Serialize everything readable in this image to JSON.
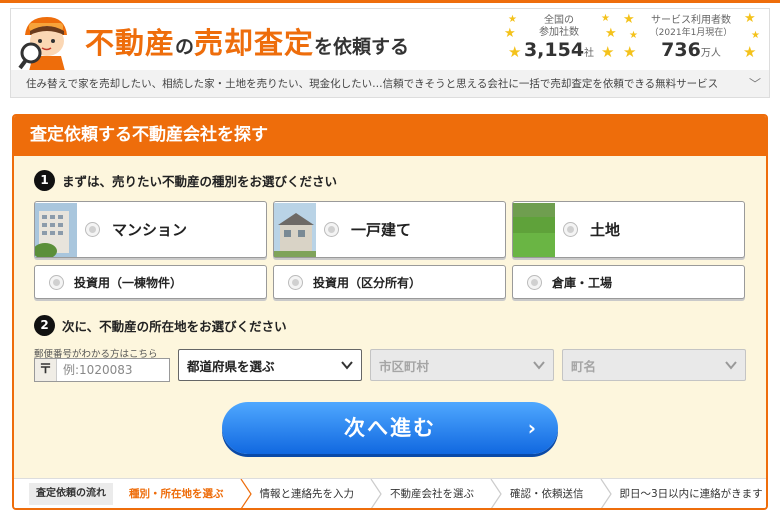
{
  "header": {
    "title_part1": "不動産",
    "title_part2": "の",
    "title_part3": "売却査定",
    "title_part4": "を依頼する",
    "stat1": {
      "label1": "全国の",
      "label2": "参加社数",
      "value": "3,154",
      "unit": "社"
    },
    "stat2": {
      "label1": "サービス利用者数",
      "label2": "（2021年1月現在）",
      "value": "736",
      "unit": "万人"
    }
  },
  "subbar": {
    "text": "住み替えで家を売却したい、相続した家・土地を売りたい、現金化したい…信頼できそうと思える会社に一括で売却査定を依頼できる無料サービス",
    "chevron": "﹀"
  },
  "panel": {
    "title": "査定依頼する不動産会社を探す"
  },
  "step1": {
    "num": "1",
    "label": "まずは、売りたい不動産の種別をお選びください"
  },
  "property_types": {
    "mansion": "マンション",
    "house": "一戸建て",
    "land": "土地"
  },
  "property_types_small": {
    "invest_building": "投資用（一棟物件）",
    "invest_unit": "投資用（区分所有）",
    "warehouse": "倉庫・工場"
  },
  "step2": {
    "num": "2",
    "label": "次に、不動産の所在地をお選びください"
  },
  "zip": {
    "label": "郵便番号がわかる方はこちら",
    "mark": "〒",
    "placeholder": "例:1020083"
  },
  "selects": {
    "prefecture": "都道府県を選ぶ",
    "city": "市区町村",
    "town": "町名"
  },
  "next_button": {
    "label": "次へ進む",
    "arrow": "›"
  },
  "flow": {
    "head": "査定依頼の流れ",
    "steps": [
      "種別・所在地を選ぶ",
      "情報と連絡先を入力",
      "不動産会社を選ぶ",
      "確認・依頼送信",
      "即日〜3日以内に連絡がきます"
    ]
  },
  "colors": {
    "accent": "#ee6d0b",
    "button": "#1168e0",
    "panel_bg": "#fdf6dd"
  }
}
